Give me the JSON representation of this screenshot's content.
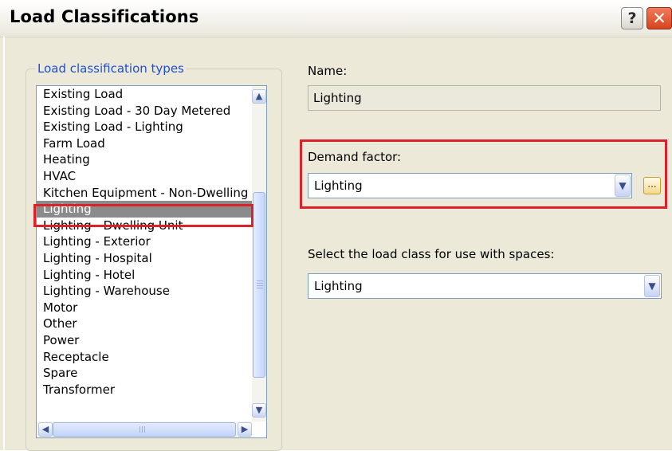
{
  "window": {
    "title": "Load Classifications",
    "help_glyph": "?",
    "close_glyph": "✕"
  },
  "group": {
    "label": "Load classification types"
  },
  "list": {
    "items": [
      "Existing Load",
      "Existing Load - 30 Day Metered",
      "Existing Load - Lighting",
      "Farm Load",
      "Heating",
      "HVAC",
      "Kitchen Equipment - Non-Dwelling",
      "Lighting",
      "Lighting - Dwelling Unit",
      "Lighting - Exterior",
      "Lighting - Hospital",
      "Lighting - Hotel",
      "Lighting - Warehouse",
      "Motor",
      "Other",
      "Power",
      "Receptacle",
      "Spare",
      "Transformer"
    ],
    "selected_index": 7,
    "vertical_scroll_position": 0.4
  },
  "icons": {
    "scroll_up": "chevron-up-icon",
    "scroll_down": "chevron-down-icon",
    "scroll_left": "chevron-left-icon",
    "scroll_right": "chevron-right-icon",
    "dropdown": "chevron-down-icon",
    "ellipsis": "ellipsis-icon"
  },
  "name_field": {
    "label": "Name:",
    "value": "Lighting"
  },
  "demand_factor": {
    "label": "Demand factor:",
    "value": "Lighting",
    "ellipsis_label": "..."
  },
  "space_load_class": {
    "label": "Select the load class for use with spaces:",
    "value": "Lighting"
  },
  "colors": {
    "highlight_outline": "#d9222a",
    "group_label": "#1c4fd6",
    "selection_bg": "#8b8b8b",
    "dialog_bg": "#ece9d8",
    "close_button": "#d8441d"
  }
}
